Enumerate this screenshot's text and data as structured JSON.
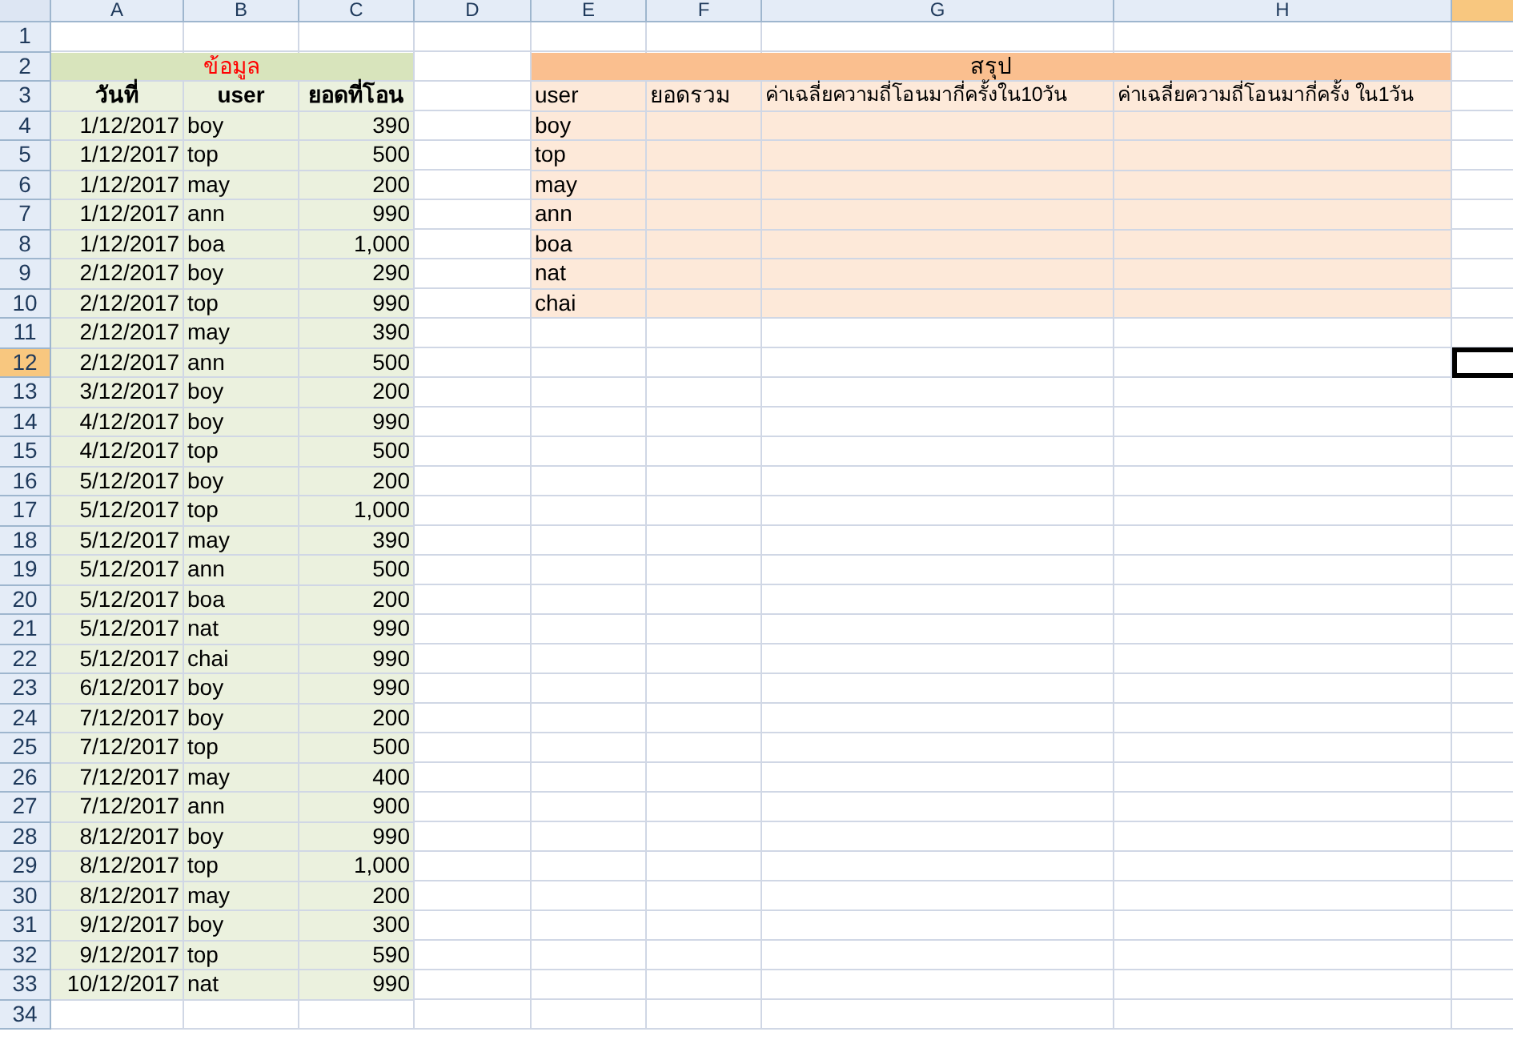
{
  "column_headers": [
    {
      "label": "A",
      "selected": false
    },
    {
      "label": "B",
      "selected": false
    },
    {
      "label": "C",
      "selected": false
    },
    {
      "label": "D",
      "selected": false
    },
    {
      "label": "E",
      "selected": false
    },
    {
      "label": "F",
      "selected": false
    },
    {
      "label": "G",
      "selected": false
    },
    {
      "label": "H",
      "selected": false
    }
  ],
  "extra_column": {
    "selected": true
  },
  "row_headers": [
    {
      "label": "1",
      "selected": false
    },
    {
      "label": "2",
      "selected": false
    },
    {
      "label": "3",
      "selected": false
    },
    {
      "label": "4",
      "selected": false
    },
    {
      "label": "5",
      "selected": false
    },
    {
      "label": "6",
      "selected": false
    },
    {
      "label": "7",
      "selected": false
    },
    {
      "label": "8",
      "selected": false
    },
    {
      "label": "9",
      "selected": false
    },
    {
      "label": "10",
      "selected": false
    },
    {
      "label": "11",
      "selected": false
    },
    {
      "label": "12",
      "selected": true
    },
    {
      "label": "13",
      "selected": false
    },
    {
      "label": "14",
      "selected": false
    },
    {
      "label": "15",
      "selected": false
    },
    {
      "label": "16",
      "selected": false
    },
    {
      "label": "17",
      "selected": false
    },
    {
      "label": "18",
      "selected": false
    },
    {
      "label": "19",
      "selected": false
    },
    {
      "label": "20",
      "selected": false
    },
    {
      "label": "21",
      "selected": false
    },
    {
      "label": "22",
      "selected": false
    },
    {
      "label": "23",
      "selected": false
    },
    {
      "label": "24",
      "selected": false
    },
    {
      "label": "25",
      "selected": false
    },
    {
      "label": "26",
      "selected": false
    },
    {
      "label": "27",
      "selected": false
    },
    {
      "label": "28",
      "selected": false
    },
    {
      "label": "29",
      "selected": false
    },
    {
      "label": "30",
      "selected": false
    },
    {
      "label": "31",
      "selected": false
    },
    {
      "label": "32",
      "selected": false
    },
    {
      "label": "33",
      "selected": false
    },
    {
      "label": "34",
      "selected": false
    }
  ],
  "data_table": {
    "title": "ข้อมูล",
    "columns": [
      "วันที่",
      "user",
      "ยอดที่โอน"
    ],
    "rows": [
      [
        "1/12/2017",
        "boy",
        "390"
      ],
      [
        "1/12/2017",
        "top",
        "500"
      ],
      [
        "1/12/2017",
        "may",
        "200"
      ],
      [
        "1/12/2017",
        "ann",
        "990"
      ],
      [
        "1/12/2017",
        "boa",
        "1,000"
      ],
      [
        "2/12/2017",
        "boy",
        "290"
      ],
      [
        "2/12/2017",
        "top",
        "990"
      ],
      [
        "2/12/2017",
        "may",
        "390"
      ],
      [
        "2/12/2017",
        "ann",
        "500"
      ],
      [
        "3/12/2017",
        "boy",
        "200"
      ],
      [
        "4/12/2017",
        "boy",
        "990"
      ],
      [
        "4/12/2017",
        "top",
        "500"
      ],
      [
        "5/12/2017",
        "boy",
        "200"
      ],
      [
        "5/12/2017",
        "top",
        "1,000"
      ],
      [
        "5/12/2017",
        "may",
        "390"
      ],
      [
        "5/12/2017",
        "ann",
        "500"
      ],
      [
        "5/12/2017",
        "boa",
        "200"
      ],
      [
        "5/12/2017",
        "nat",
        "990"
      ],
      [
        "5/12/2017",
        "chai",
        "990"
      ],
      [
        "6/12/2017",
        "boy",
        "990"
      ],
      [
        "7/12/2017",
        "boy",
        "200"
      ],
      [
        "7/12/2017",
        "top",
        "500"
      ],
      [
        "7/12/2017",
        "may",
        "400"
      ],
      [
        "7/12/2017",
        "ann",
        "900"
      ],
      [
        "8/12/2017",
        "boy",
        "990"
      ],
      [
        "8/12/2017",
        "top",
        "1,000"
      ],
      [
        "8/12/2017",
        "may",
        "200"
      ],
      [
        "9/12/2017",
        "boy",
        "300"
      ],
      [
        "9/12/2017",
        "top",
        "590"
      ],
      [
        "10/12/2017",
        "nat",
        "990"
      ]
    ]
  },
  "summary_table": {
    "title": "สรุป",
    "columns": [
      "user",
      "ยอดรวม",
      "ค่าเฉลี่ยความถี่โอนมากี่ครั้งใน10วัน",
      "ค่าเฉลี่ยความถี่โอนมากี่ครั้ง ใน1วัน"
    ],
    "users": [
      "boy",
      "top",
      "may",
      "ann",
      "boa",
      "nat",
      "chai"
    ]
  }
}
